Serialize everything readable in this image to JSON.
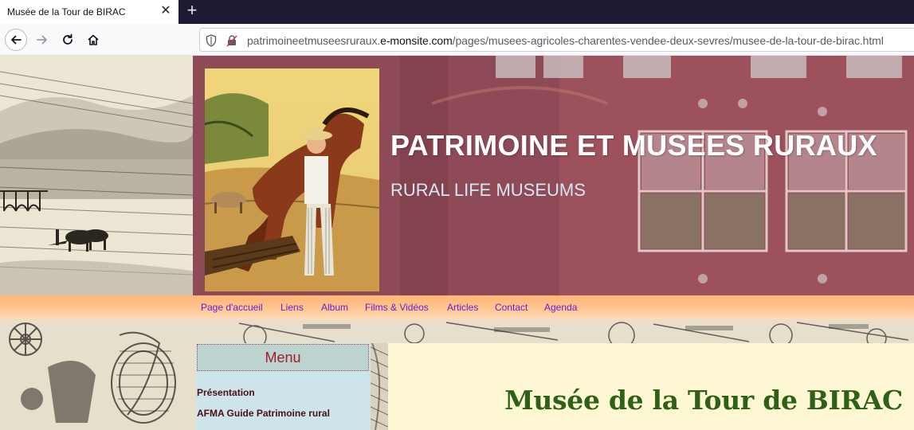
{
  "browser": {
    "tab": {
      "title": "Musée de la Tour de BIRAC",
      "close_icon": "close-icon"
    },
    "new_tab_icon": "plus-icon",
    "nav": {
      "back_icon": "arrow-left-icon",
      "forward_icon": "arrow-right-icon",
      "reload_icon": "reload-icon",
      "home_icon": "home-icon"
    },
    "url": {
      "prefix": "patrimoineetmuseesruraux.",
      "domain": "e-monsite.com",
      "path": "/pages/musees-agricoles-charentes-vendee-deux-sevres/musee-de-la-tour-de-birac.html"
    }
  },
  "site": {
    "title": "PATRIMOINE ET MUSEES RURAUX",
    "subtitle": "RURAL LIFE MUSEUMS"
  },
  "menu": {
    "items": [
      {
        "label": "Page d'accueil"
      },
      {
        "label": "Liens"
      },
      {
        "label": "Album"
      },
      {
        "label": "Films & Vidéos"
      },
      {
        "label": "Articles"
      },
      {
        "label": "Contact"
      },
      {
        "label": "Agenda"
      }
    ]
  },
  "sidebar": {
    "heading": "Menu",
    "links": [
      {
        "label": "Présentation"
      },
      {
        "label": "AFMA Guide Patrimoine rural"
      }
    ]
  },
  "content": {
    "page_title": "Musée de la Tour de BIRAC"
  },
  "colors": {
    "tabbar": "#1c1b33",
    "header": "#944e5b",
    "menubar": "#ffc48e",
    "menu_link": "#6a1bd6",
    "sidebar": "#cde4ea",
    "sidebar_heading": "#a11e2e",
    "content_bg": "#fdf8d3",
    "page_title": "#2e6116"
  }
}
